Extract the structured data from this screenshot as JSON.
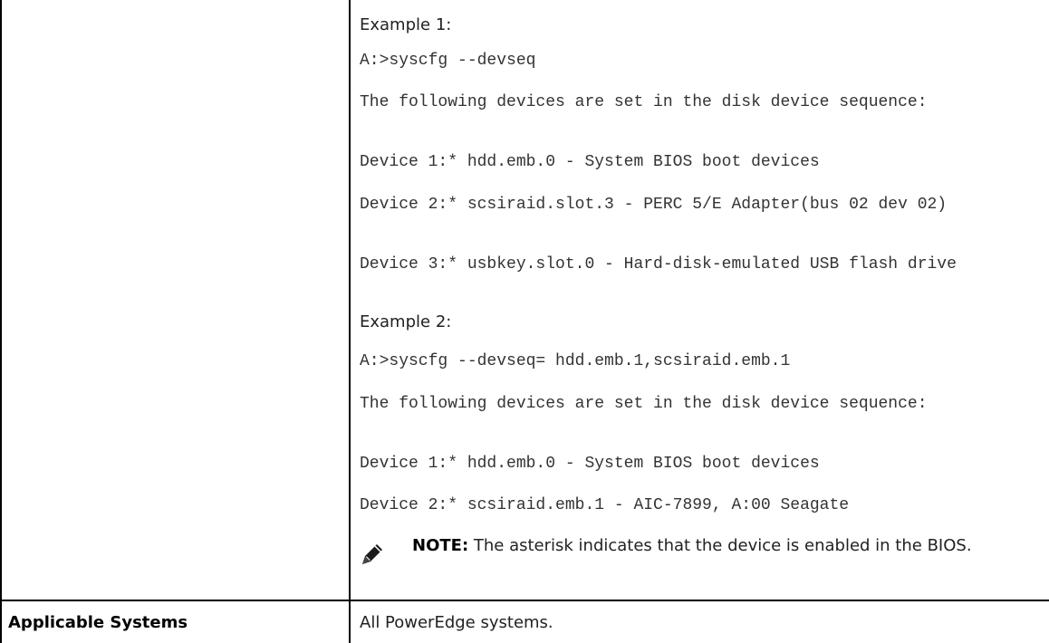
{
  "example1": {
    "heading": "Example 1:",
    "command": "A:>syscfg --devseq",
    "intro": "The following devices are set in the disk device sequence:",
    "devices": [
      "Device 1:* hdd.emb.0 - System BIOS boot devices",
      "Device 2:* scsiraid.slot.3 - PERC 5/E Adapter(bus 02 dev 02)",
      "Device 3:* usbkey.slot.0 - Hard-disk-emulated USB flash drive"
    ]
  },
  "example2": {
    "heading": "Example 2:",
    "command": "A:>syscfg --devseq= hdd.emb.1,scsiraid.emb.1",
    "intro": "The following devices are set in the disk device sequence:",
    "devices": [
      "Device 1:* hdd.emb.0 - System BIOS boot devices",
      "Device 2:* scsiraid.emb.1 - AIC-7899, A:00 Seagate"
    ]
  },
  "note": {
    "label": "NOTE:",
    "text": "The asterisk indicates that the device is enabled in the BIOS.",
    "icon": "pencil-icon"
  },
  "applicable_systems": {
    "label": "Applicable Systems",
    "value": "All PowerEdge systems."
  }
}
